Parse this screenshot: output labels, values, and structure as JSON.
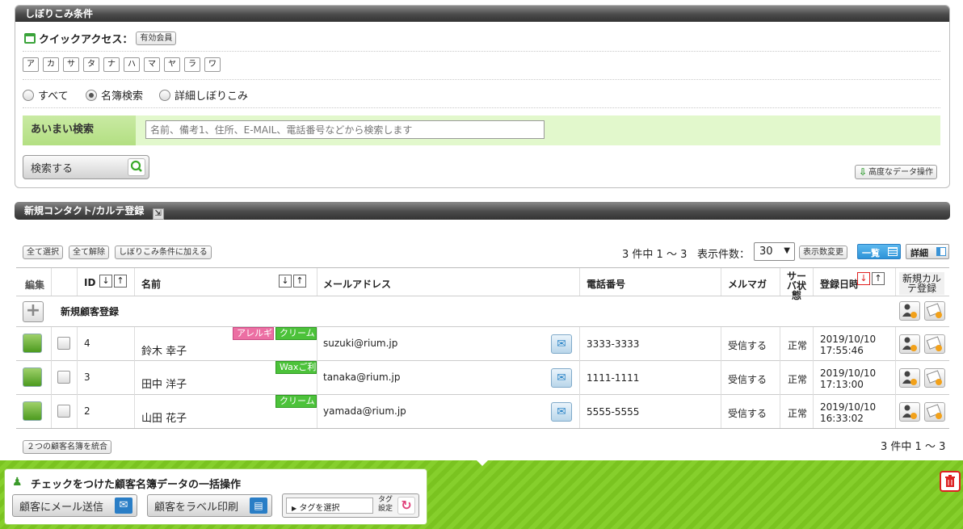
{
  "filter": {
    "title": "しぼりこみ条件",
    "quick_label": "クイックアクセス：",
    "quick_btn": "有効会員",
    "kana": [
      "ア",
      "カ",
      "サ",
      "タ",
      "ナ",
      "ハ",
      "マ",
      "ヤ",
      "ラ",
      "ワ"
    ],
    "radios": [
      {
        "label": "すべて",
        "checked": false
      },
      {
        "label": "名簿検索",
        "checked": true
      },
      {
        "label": "詳細しぼりこみ",
        "checked": false
      }
    ],
    "fuzzy_label": "あいまい検索",
    "search_placeholder": "名前、備考1、住所、E-MAIL、電話番号などから検索します",
    "search_btn": "検索する",
    "advanced_btn": "高度なデータ操作"
  },
  "newcontact": {
    "title": "新規コンタクト/カルテ登録"
  },
  "toolbar": {
    "select_all": "全て選択",
    "deselect_all": "全て解除",
    "add_filter": "しぼりこみ条件に加える",
    "count": "3 件中 1 ～ 3",
    "per_page_label": "表示件数：",
    "per_page": "30",
    "change_btn": "表示数変更",
    "view_list": "一覧",
    "view_detail": "詳細"
  },
  "table": {
    "headers": {
      "edit": "編集",
      "id": "ID",
      "name": "名前",
      "mail": "メールアドレス",
      "phone": "電話番号",
      "mailmag": "メルマガ",
      "server": "サーバ状態",
      "date": "登録日時",
      "new": "新規カルテ登録"
    },
    "new_row_label": "新規顧客登録",
    "rows": [
      {
        "id": "4",
        "name": "鈴木 幸子",
        "mail": "suzuki@rium.jp",
        "phone": "3333-3333",
        "mailmag": "受信する",
        "server": "正常",
        "date1": "2019/10/10",
        "date2": "17:55:46",
        "tags": [
          "アレルギ",
          "クリーム"
        ]
      },
      {
        "id": "3",
        "name": "田中 洋子",
        "mail": "tanaka@rium.jp",
        "phone": "1111-1111",
        "mailmag": "受信する",
        "server": "正常",
        "date1": "2019/10/10",
        "date2": "17:13:00",
        "tags": [
          "Waxご利"
        ]
      },
      {
        "id": "2",
        "name": "山田 花子",
        "mail": "yamada@rium.jp",
        "phone": "5555-5555",
        "mailmag": "受信する",
        "server": "正常",
        "date1": "2019/10/10",
        "date2": "16:33:02",
        "tags": [
          "クリーム"
        ]
      }
    ],
    "merge_btn": "２つの顧客名簿を統合",
    "count_bottom": "3 件中 1 ～ 3"
  },
  "bulk": {
    "title": "チェックをつけた顧客名簿データの一括操作",
    "mail_btn": "顧客にメール送信",
    "label_btn": "顧客をラベル印刷",
    "tag_select": "タグを選択",
    "tag_set": "タグ設定"
  },
  "colors": {
    "green": "#7ac320",
    "fuzzy_bg": "#ddf5c4",
    "accent_blue": "#3399dd",
    "tag_pink": "#ec6fa3",
    "tag_green": "#4cc23a"
  }
}
